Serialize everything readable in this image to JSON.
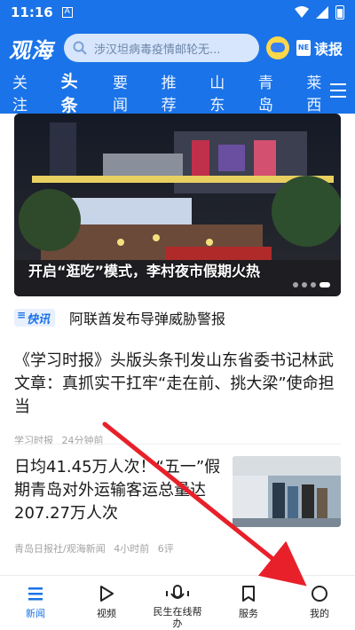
{
  "status_bar": {
    "time": "11:16",
    "sim_label": "A"
  },
  "header": {
    "logo": "观海",
    "search_placeholder": "涉汉坦病毒疫情邮轮无...",
    "read_paper_label": "读报"
  },
  "tabs": [
    "关注",
    "头条",
    "要闻",
    "推荐",
    "山东",
    "青岛",
    "莱西"
  ],
  "active_tab": "头条",
  "banner": {
    "caption": "开启“逛吃”模式，李村夜市假期火热"
  },
  "flash": {
    "badge": "快讯",
    "text": "阿联酋发布导弹威胁警报"
  },
  "articles": [
    {
      "title": "《学习时报》头版头条刊发山东省委书记林武文章：真抓实干扛牢“走在前、挑大梁”使命担当",
      "source": "学习时报",
      "time": "24分钟前"
    },
    {
      "title": "日均41.45万人次！“五一”假期青岛对外运输客运总量达207.27万人次",
      "source": "青岛日报社/观海新闻",
      "time": "4小时前",
      "comments": "6评"
    }
  ],
  "bottom_nav": [
    {
      "label": "新闻",
      "icon": "list-icon"
    },
    {
      "label": "视频",
      "icon": "play-icon"
    },
    {
      "label": "民生在线帮办",
      "icon": "microphone-icon"
    },
    {
      "label": "服务",
      "icon": "bookmark-icon"
    },
    {
      "label": "我的",
      "icon": "profile-circle-icon"
    }
  ],
  "colors": {
    "brand_blue": "#1a73e8",
    "annotation_red": "#e8202a"
  }
}
